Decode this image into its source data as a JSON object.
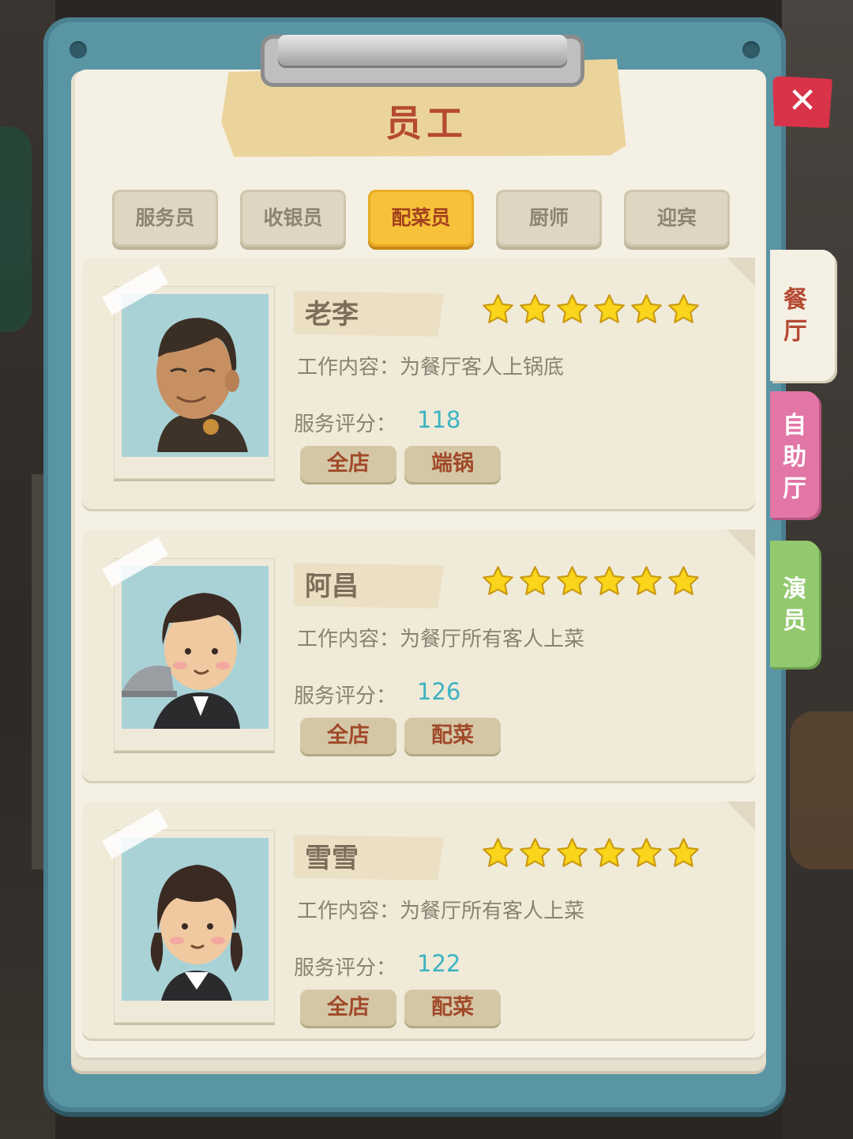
{
  "title": "员工",
  "tabs": [
    "服务员",
    "收银员",
    "配菜员",
    "厨师",
    "迎宾"
  ],
  "active_tab": 2,
  "side_tabs": [
    "餐厅",
    "自助厅",
    "演员"
  ],
  "close_label": "✕",
  "labels": {
    "job_prefix": "工作内容：",
    "rating_prefix": "服务评分："
  },
  "staff": [
    {
      "name": "老李",
      "job": "为餐厅客人上锅底",
      "rating": "118",
      "stars": 6,
      "tags": [
        "全店",
        "端锅"
      ]
    },
    {
      "name": "阿昌",
      "job": "为餐厅所有客人上菜",
      "rating": "126",
      "stars": 6,
      "tags": [
        "全店",
        "配菜"
      ]
    },
    {
      "name": "雪雪",
      "job": "为餐厅所有客人上菜",
      "rating": "122",
      "stars": 6,
      "tags": [
        "全店",
        "配菜"
      ]
    }
  ],
  "colors": {
    "active_tab": "#f7c23a",
    "board": "#5a95a4",
    "rating": "#3cb4c2",
    "star": "#f9d51b",
    "close": "#d9334a"
  }
}
